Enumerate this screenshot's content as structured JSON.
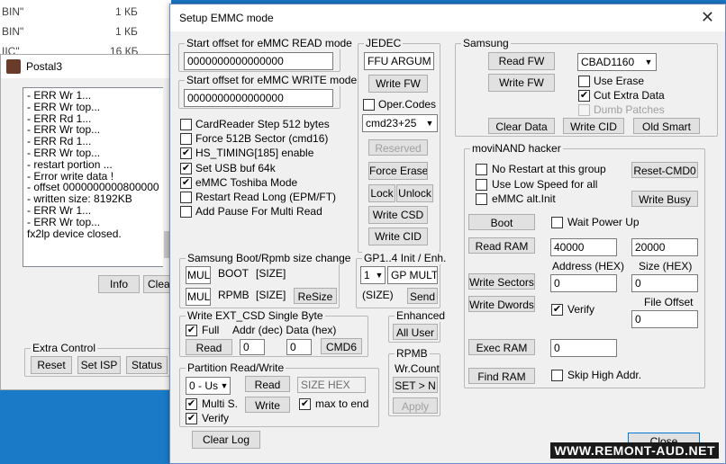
{
  "background_window": {
    "file_rows": [
      {
        "name": "BIN\"",
        "size": "1 КБ"
      },
      {
        "name": "BIN\"",
        "size": "1 КБ"
      },
      {
        "name": "IIC\"",
        "size": "16 КБ"
      }
    ],
    "title": "Postal3",
    "log_lines": [
      "- ERR Wr 1...",
      "- ERR Wr top...",
      "- ERR Rd 1...",
      "- ERR Wr top...",
      "- ERR Rd 1...",
      "- ERR Wr top...",
      "- restart portion ...",
      "- Error write data !",
      "- offset 0000000000800000",
      "- written size: 8192KB",
      "- ERR Wr 1...",
      "- ERR Wr top...",
      "fx2lp device closed."
    ],
    "info_label": "Info",
    "clear_label": "Clear",
    "extra_control": {
      "caption": "Extra Control",
      "reset_label": "Reset",
      "set_isp_label": "Set ISP",
      "status_label": "Status"
    }
  },
  "dialog": {
    "title": "Setup EMMC mode",
    "close_glyph": "✕",
    "read_offset": {
      "caption": "Start offset for eMMC READ mode",
      "value": "0000000000000000"
    },
    "write_offset": {
      "caption": "Start offset for eMMC WRITE mode",
      "value": "0000000000000000"
    },
    "options": [
      {
        "label": "CardReader Step 512 bytes",
        "checked": false
      },
      {
        "label": "Force 512B Sector (cmd16)",
        "checked": false
      },
      {
        "label": "HS_TIMING[185] enable",
        "checked": true
      },
      {
        "label": "Set USB buf 64k",
        "checked": true
      },
      {
        "label": "eMMC Toshiba Mode",
        "checked": true
      },
      {
        "label": "Restart Read Long (EPM/FT)",
        "checked": false
      },
      {
        "label": "Add Pause For Multi Read",
        "checked": false
      }
    ],
    "jedec": {
      "caption": "JEDEC",
      "ffu_value": "FFU ARGUM",
      "write_ffu_label": "Write FW",
      "oper_codes_label": "Oper.Codes",
      "oper_codes_checked": false,
      "cmd_select": "cmd23+25",
      "reserved_label": "Reserved",
      "force_erase_label": "Force Erase",
      "lock_label": "Lock",
      "unlock_label": "Unlock",
      "write_csd_label": "Write CSD",
      "write_cid_label": "Write CID"
    },
    "samsung": {
      "caption": "Samsung",
      "read_fw_label": "Read FW",
      "write_fw_label": "Write FW",
      "model_select": "CBAD1160",
      "use_erase_label": "Use Erase",
      "use_erase_checked": false,
      "cut_extra_label": "Cut Extra Data",
      "cut_extra_checked": true,
      "dumb_patches_label": "Dumb Patches",
      "clear_data_label": "Clear Data",
      "write_cid_label": "Write CID",
      "old_smart_label": "Old Smart"
    },
    "movinand": {
      "caption": "moviNAND hacker",
      "no_restart_label": "No Restart at this group",
      "low_speed_label": "Use Low Speed for all",
      "alt_init_label": "eMMC alt.Init",
      "reset_cmd0_label": "Reset-CMD0",
      "write_busy_label": "Write Busy",
      "boot_label": "Boot",
      "wait_power_up_label": "Wait Power Up",
      "read_ram_label": "Read RAM",
      "address_value": "40000",
      "size_value": "20000",
      "address_caption": "Address (HEX)",
      "size_caption": "Size (HEX)",
      "write_sectors_label": "Write Sectors",
      "address2_value": "0",
      "size2_value": "0",
      "file_offset_caption": "File Offset",
      "write_dwords_label": "Write Dwords",
      "verify_label": "Verify",
      "verify_checked": true,
      "file_offset_value": "0",
      "exec_ram_label": "Exec RAM",
      "exec_value": "0",
      "find_ram_label": "Find RAM",
      "skip_high_label": "Skip High Addr."
    },
    "boot_rpmb": {
      "caption": "Samsung Boot/Rpmb size change",
      "boot_input": "MUL",
      "boot_label": "BOOT",
      "boot_size": "[SIZE]",
      "rpmb_input": "MUL",
      "rpmb_label": "RPMB",
      "rpmb_size": "[SIZE]",
      "resize_label": "ReSize"
    },
    "gp": {
      "caption": "GP1..4 Init / Enh.",
      "num_select": "1",
      "mode_value": "GP MULT",
      "size_label": "(SIZE)",
      "send_label": "Send"
    },
    "ext_csd": {
      "caption": "Write EXT_CSD Single Byte",
      "full_label": "Full",
      "full_checked": true,
      "header_label": "Addr (dec) Data (hex)",
      "read_label": "Read",
      "addr_value": "0",
      "data_value": "0",
      "cmd6_label": "CMD6"
    },
    "enhanced": {
      "caption": "Enhanced",
      "all_user_label": "All User"
    },
    "partition": {
      "caption": "Partition Read/Write",
      "select_value": "0 - Us",
      "read_label": "Read",
      "size_hex_placeholder": "SIZE HEX",
      "multi_label": "Multi S.",
      "multi_checked": true,
      "write_label": "Write",
      "max_to_end_label": "max to end",
      "max_to_end_checked": true,
      "verify_label": "Verify",
      "verify_checked": true
    },
    "rpmb": {
      "caption": "RPMB",
      "wr_count_label": "Wr.Count",
      "set_n_label": "SET > N",
      "apply_label": "Apply"
    },
    "clear_log_label": "Clear Log",
    "close_label": "Close"
  },
  "watermark": "WWW.REMONT-AUD.NET"
}
